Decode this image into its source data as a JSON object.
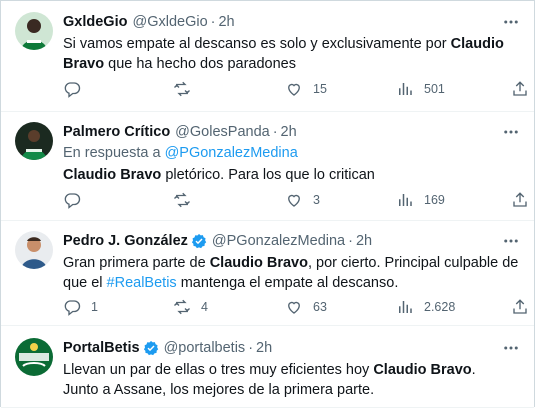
{
  "tweets": [
    {
      "name": "GxldeGio",
      "handle": "@GxldeGio",
      "separator": "·",
      "time": "2h",
      "verified": false,
      "reply_to": null,
      "text_parts": [
        {
          "t": "Si vamos empate al descanso es solo y exclusivamente por ",
          "style": "normal"
        },
        {
          "t": "Claudio Bravo",
          "style": "bold"
        },
        {
          "t": " que ha hecho dos paradones",
          "style": "normal"
        }
      ],
      "replies": "",
      "retweets": "",
      "likes": "15",
      "views": "501"
    },
    {
      "name": "Palmero Crítico",
      "handle": "@GolesPanda",
      "separator": "·",
      "time": "2h",
      "verified": false,
      "reply_to": {
        "prefix": "En respuesta a",
        "user": "@PGonzalezMedina"
      },
      "text_parts": [
        {
          "t": "Claudio Bravo",
          "style": "bold"
        },
        {
          "t": " pletórico. Para los que lo critican",
          "style": "normal"
        }
      ],
      "replies": "",
      "retweets": "",
      "likes": "3",
      "views": "169"
    },
    {
      "name": "Pedro J. González",
      "handle": "@PGonzalezMedina",
      "separator": "·",
      "time": "2h",
      "verified": true,
      "reply_to": null,
      "text_parts": [
        {
          "t": "Gran primera parte de ",
          "style": "normal"
        },
        {
          "t": "Claudio Bravo",
          "style": "bold"
        },
        {
          "t": ", por cierto. Principal culpable de que el ",
          "style": "normal"
        },
        {
          "t": "#RealBetis",
          "style": "hashtag"
        },
        {
          "t": " mantenga el empate al descanso.",
          "style": "normal"
        }
      ],
      "replies": "1",
      "retweets": "4",
      "likes": "63",
      "views": "2.628"
    },
    {
      "name": "PortalBetis",
      "handle": "@portalbetis",
      "separator": "·",
      "time": "2h",
      "verified": true,
      "reply_to": null,
      "text_parts": [
        {
          "t": "Llevan un par de ellas o tres muy eficientes hoy ",
          "style": "normal"
        },
        {
          "t": "Claudio Bravo",
          "style": "bold"
        },
        {
          "t": ". ",
          "style": "normal"
        },
        {
          "t": "\nJunto a Assane, los mejores de la primera parte.",
          "style": "normal"
        }
      ],
      "replies": "",
      "retweets": "",
      "likes": "",
      "views": ""
    }
  ],
  "icons": {
    "reply": "reply-icon",
    "retweet": "retweet-icon",
    "like": "heart-icon",
    "views": "views-icon",
    "share": "share-icon",
    "more": "more-icon",
    "verified": "verified-badge-icon"
  },
  "colors": {
    "link": "#1d9bf0",
    "muted": "#536471",
    "text": "#0f1419",
    "divider": "#eff3f4"
  }
}
